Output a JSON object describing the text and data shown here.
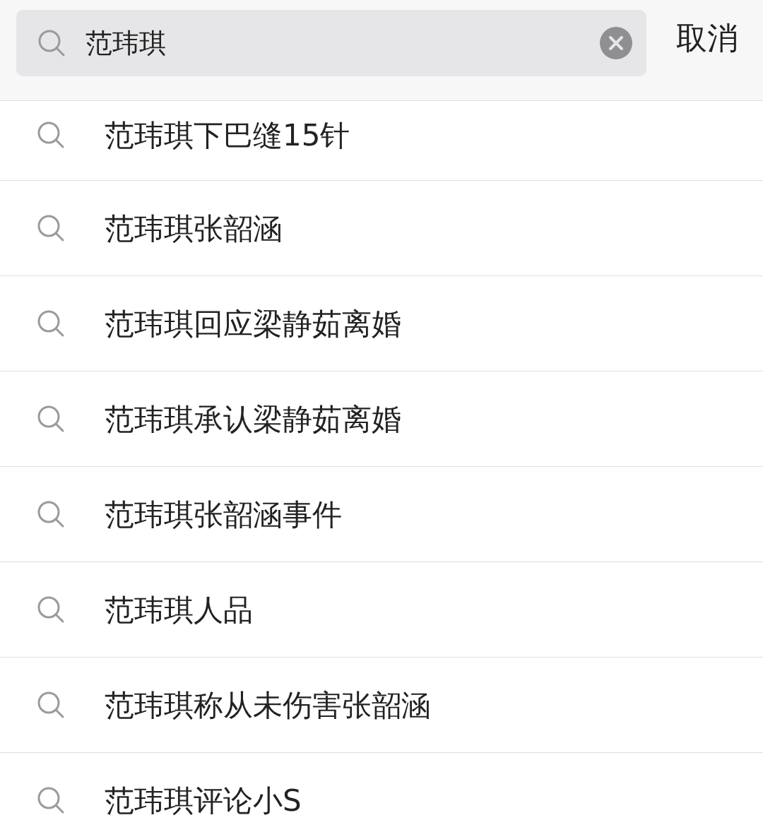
{
  "search": {
    "value": "范玮琪",
    "cancel": "取消"
  },
  "suggestions": [
    {
      "text": "范玮琪下巴缝15针"
    },
    {
      "text": "范玮琪张韶涵"
    },
    {
      "text": "范玮琪回应梁静茹离婚"
    },
    {
      "text": "范玮琪承认梁静茹离婚"
    },
    {
      "text": "范玮琪张韶涵事件"
    },
    {
      "text": "范玮琪人品"
    },
    {
      "text": "范玮琪称从未伤害张韶涵"
    },
    {
      "text": "范玮琪评论小S"
    }
  ]
}
